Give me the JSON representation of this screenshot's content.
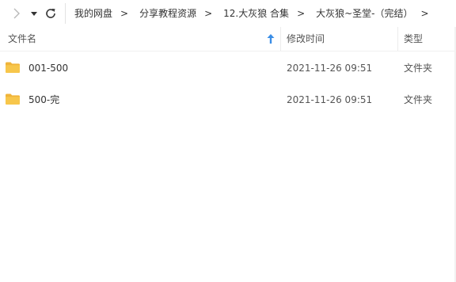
{
  "nav": {
    "forward_icon": "chevron-right-icon",
    "history_icon": "dropdown-arrow-icon",
    "refresh_icon": "refresh-icon"
  },
  "breadcrumb": [
    {
      "label": "我的网盘"
    },
    {
      "label": "分享教程资源"
    },
    {
      "label": "12.大灰狼 合集"
    },
    {
      "label": "大灰狼~圣堂-（完结）"
    }
  ],
  "breadcrumb_separator": ">",
  "columns": {
    "name": "文件名",
    "date": "修改时间",
    "type": "类型",
    "sort_icon": "sort-ascending-icon"
  },
  "files": [
    {
      "name": "001-500",
      "date": "2021-11-26 09:51",
      "type": "文件夹",
      "icon": "folder-icon"
    },
    {
      "name": "500-完",
      "date": "2021-11-26 09:51",
      "type": "文件夹",
      "icon": "folder-icon"
    }
  ],
  "colors": {
    "folder": "#f7c64b",
    "folder_tab": "#f0b43a",
    "sort_arrow": "#3a8ee6",
    "text": "#333333",
    "muted": "#555555"
  }
}
